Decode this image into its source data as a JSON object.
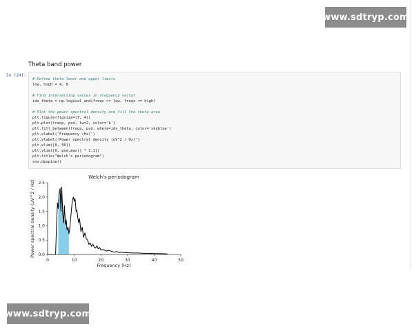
{
  "watermarks": {
    "top": "www.sdtryp.com",
    "bottom": "www.sdtryp.com"
  },
  "notebook": {
    "section_heading": "Theta band power",
    "cell_prompt": "In [24]:",
    "code_lines": [
      {
        "text": "# Define theta lower and upper limits",
        "kind": "comment"
      },
      {
        "text": "low, high = 4, 8",
        "kind": "code"
      },
      {
        "text": "",
        "kind": "blank"
      },
      {
        "text": "# Find intersecting values in frequency vector",
        "kind": "comment"
      },
      {
        "text": "idx_theta = np.logical_and(freqs >= low, freqs <= high)",
        "kind": "code"
      },
      {
        "text": "",
        "kind": "blank"
      },
      {
        "text": "# Plot the power spectral density and fill the theta area",
        "kind": "comment"
      },
      {
        "text": "plt.figure(figsize=(7, 4))",
        "kind": "code"
      },
      {
        "text": "plt.plot(freqs, psd, lw=2, color='k')",
        "kind": "code"
      },
      {
        "text": "plt.fill_between(freqs, psd, where=idx_theta, color='skyblue')",
        "kind": "code"
      },
      {
        "text": "plt.xlabel('Frequency (Hz)')",
        "kind": "code"
      },
      {
        "text": "plt.ylabel('Power spectral density (uV^2 / Hz)')",
        "kind": "code"
      },
      {
        "text": "plt.xlim([0, 50])",
        "kind": "code"
      },
      {
        "text": "plt.ylim([0, psd.max() * 1.1])",
        "kind": "code"
      },
      {
        "text": "plt.title(\"Welch's periodogram\")",
        "kind": "code"
      },
      {
        "text": "sns.despine()",
        "kind": "code"
      }
    ]
  },
  "chart_data": {
    "type": "line",
    "title": "Welch's periodogram",
    "xlabel": "Frequency (Hz)",
    "ylabel": "Power spectral density (uV^2 / Hz)",
    "xlim": [
      0,
      50
    ],
    "ylim": [
      0,
      2.5
    ],
    "xticks": [
      0,
      10,
      20,
      30,
      40,
      50
    ],
    "yticks": [
      0.0,
      0.5,
      1.0,
      1.5,
      2.0,
      2.5
    ],
    "xtick_labels": [
      "0",
      "10",
      "20",
      "30",
      "40",
      "50"
    ],
    "ytick_labels": [
      "0.0",
      "0.5",
      "1.0",
      "1.5",
      "2.0",
      "2.5"
    ],
    "grid": false,
    "line_color": "#000000",
    "fill_color": "#87ceeb",
    "fill_band": [
      4,
      8
    ],
    "series": [
      {
        "x": [
          0,
          3,
          3.3,
          3.7,
          4.0,
          4.3,
          4.7,
          5.0,
          5.3,
          5.7,
          6.0,
          6.3,
          6.7,
          7.0,
          7.3,
          7.7,
          8.0,
          8.3,
          8.7,
          9.0,
          9.3,
          9.7,
          10.0,
          10.3,
          10.7,
          11.0,
          11.3,
          11.7,
          12.0,
          12.5,
          13.0,
          13.5,
          14.0,
          14.5,
          15.0,
          15.5,
          16.0,
          16.5,
          17.0,
          17.5,
          18.0,
          18.5,
          19.0,
          19.5,
          20.0,
          21.0,
          22.0,
          23.0,
          24.0,
          25.0,
          26.0,
          27.0,
          28.0,
          29.0,
          30.0,
          32.0,
          34.0,
          36.0,
          38.0,
          40.0,
          42.0,
          44.0,
          45.0
        ],
        "y": [
          0.0,
          0.0,
          0.9,
          1.8,
          1.6,
          2.1,
          2.3,
          1.5,
          2.35,
          1.4,
          1.1,
          1.7,
          1.05,
          1.2,
          0.85,
          0.95,
          0.72,
          0.9,
          1.3,
          1.6,
          1.9,
          2.0,
          1.85,
          1.95,
          1.5,
          1.55,
          1.3,
          1.1,
          1.25,
          0.8,
          0.95,
          0.6,
          0.75,
          0.55,
          0.5,
          0.35,
          0.4,
          0.28,
          0.36,
          0.26,
          0.22,
          0.3,
          0.2,
          0.24,
          0.16,
          0.17,
          0.12,
          0.14,
          0.11,
          0.08,
          0.1,
          0.07,
          0.08,
          0.06,
          0.06,
          0.05,
          0.05,
          0.04,
          0.04,
          0.03,
          0.03,
          0.02,
          0.02
        ]
      }
    ]
  }
}
